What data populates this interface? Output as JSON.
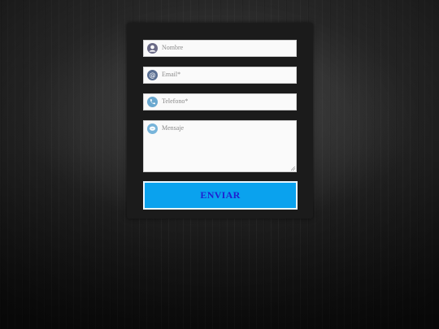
{
  "form": {
    "name_placeholder": "Nombre",
    "email_placeholder": "Email*",
    "phone_placeholder": "Telefono*",
    "message_placeholder": "Mensaje",
    "submit_label": "ENVIAR"
  },
  "icons": {
    "name": "user-icon",
    "email": "at-sign-icon",
    "phone": "phone-icon",
    "message": "chat-bubble-icon"
  },
  "colors": {
    "button": "#0aa2ee",
    "button_text": "#2020d0",
    "icon_user": "#6a6a86",
    "icon_email": "#5a6f92",
    "icon_phone": "#6aa8cf",
    "icon_chat": "#77b4da"
  }
}
